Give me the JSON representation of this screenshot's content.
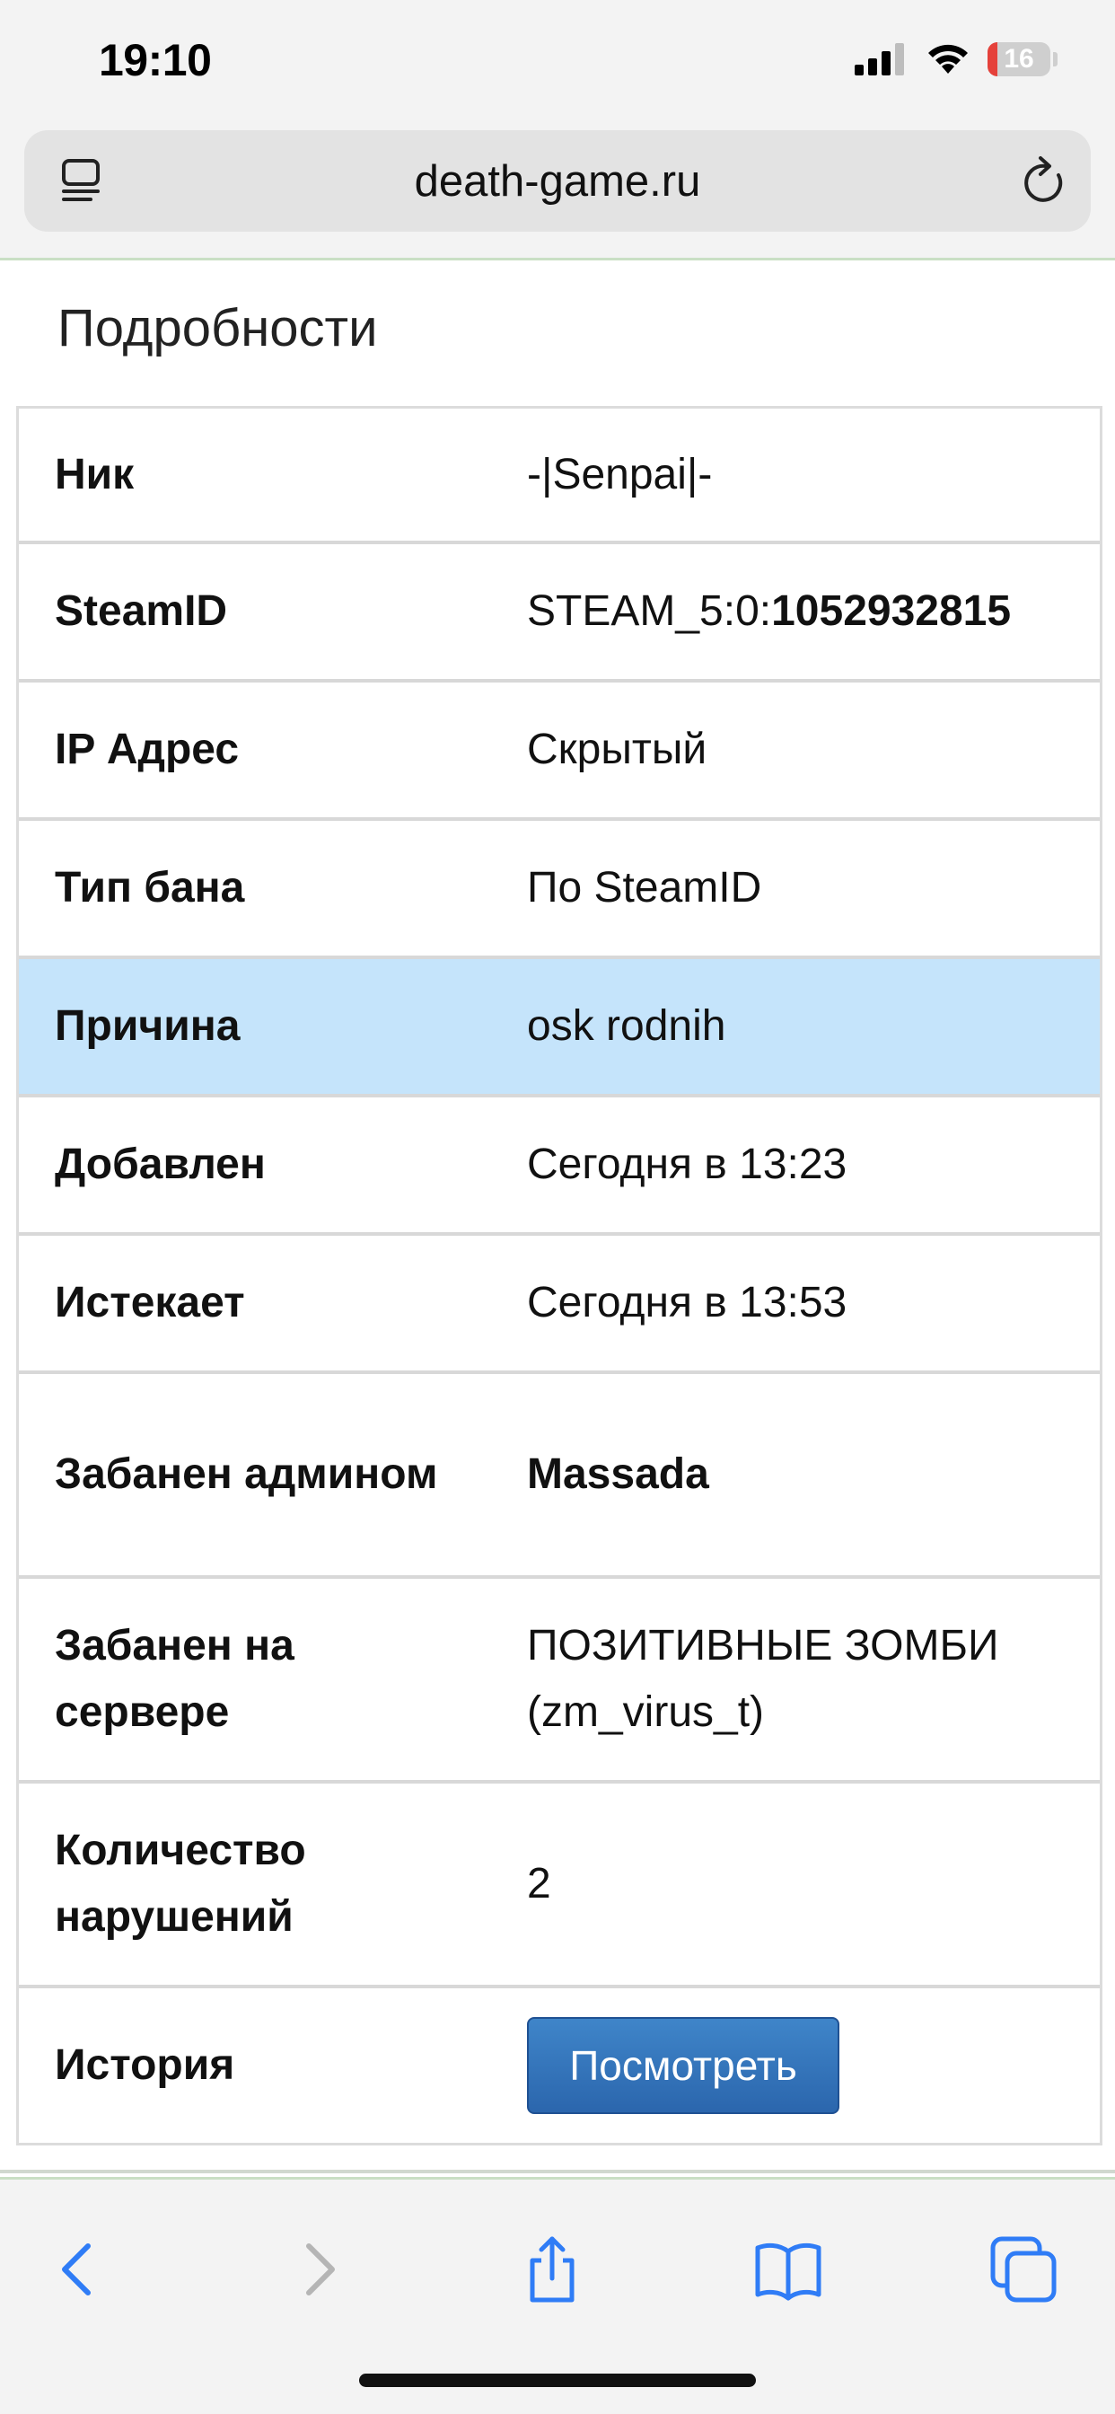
{
  "status_bar": {
    "time": "19:10",
    "battery_percent": "16",
    "battery_level": 0.16,
    "icons": [
      "signal-icon",
      "wifi-icon",
      "battery-icon"
    ]
  },
  "browser": {
    "url": "death-game.ru",
    "icons": [
      "reader-icon",
      "reload-icon",
      "back-icon",
      "forward-icon",
      "share-icon",
      "bookmarks-icon",
      "tabs-icon"
    ]
  },
  "page": {
    "title": "Подробности",
    "rows": [
      {
        "label": "Ник",
        "value": "-|Senpai|-"
      },
      {
        "label": "SteamID",
        "value_prefix": "STEAM_5:0:",
        "value_bold": "1052932815"
      },
      {
        "label": "IP Адрес",
        "value": "Скрытый"
      },
      {
        "label": "Тип бана",
        "value": "По SteamID"
      },
      {
        "label": "Причина",
        "value": "osk rodnih"
      },
      {
        "label": "Добавлен",
        "value": "Сегодня в 13:23"
      },
      {
        "label": "Истекает",
        "value": "Сегодня в 13:53"
      },
      {
        "label": "Забанен админом",
        "value": "Massada"
      },
      {
        "label": "Забанен на сервере",
        "value": "ПОЗИТИВНЫЕ ЗОМБИ (zm_virus_t)"
      },
      {
        "label": "Количество нарушений",
        "value": "2"
      },
      {
        "label": "История",
        "button_label": "Посмотреть"
      }
    ]
  },
  "colors": {
    "highlight_row": "#c5e4fb",
    "button": "#2f6fb5",
    "ios_blue": "#2f7cf6",
    "battery_red": "#e5413a"
  }
}
